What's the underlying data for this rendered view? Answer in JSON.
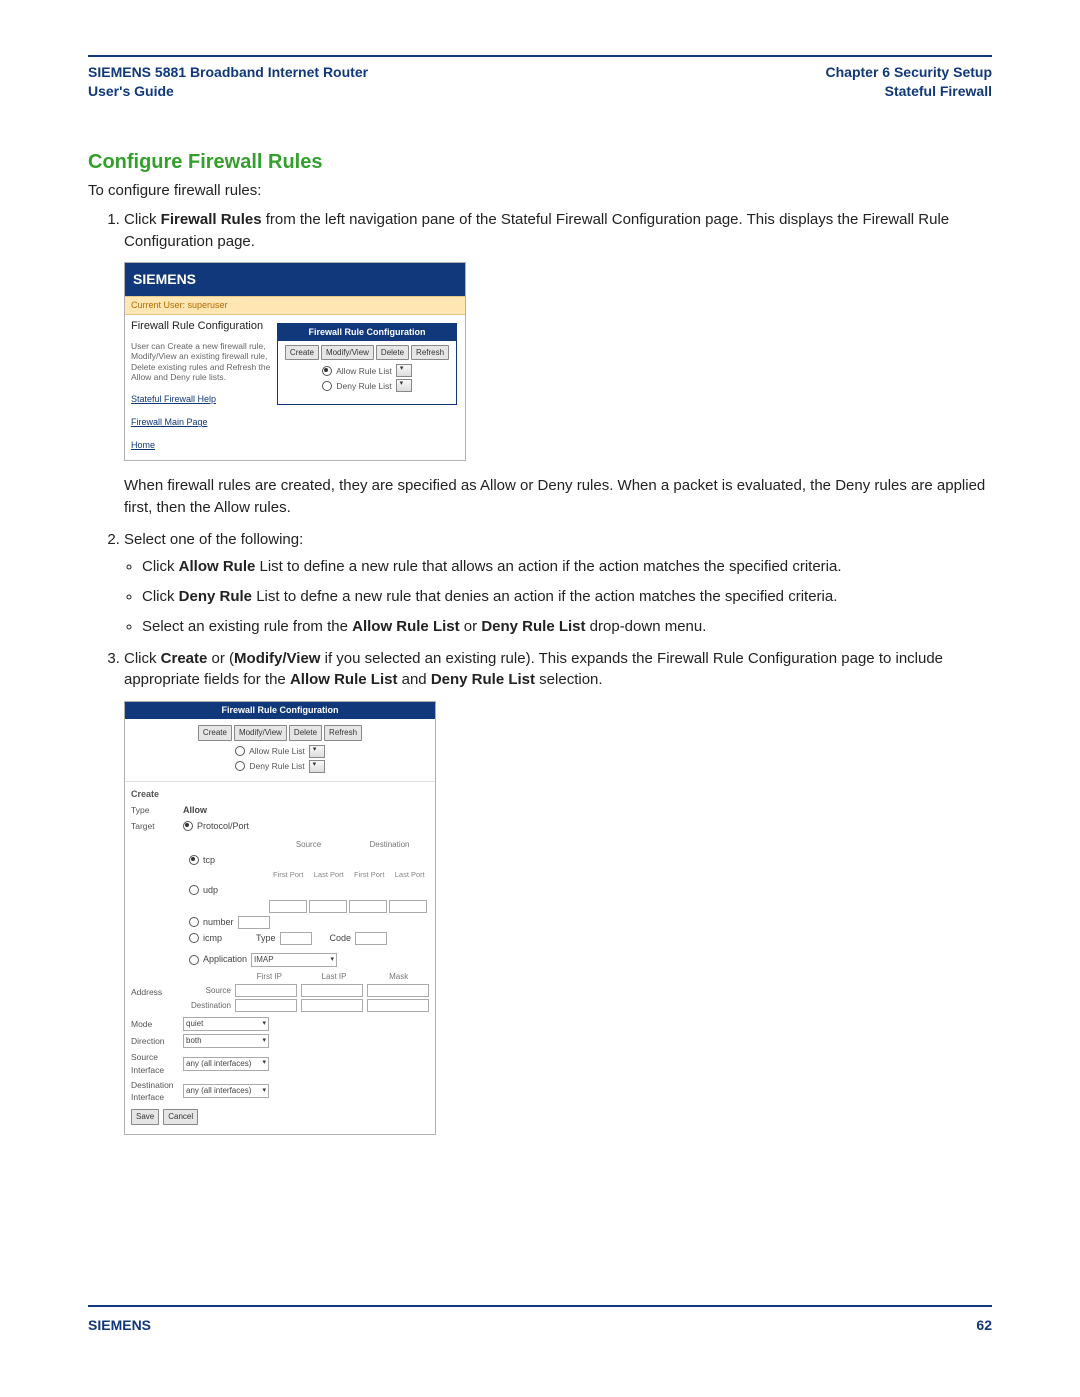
{
  "header": {
    "product": "SIEMENS 5881 Broadband Internet Router",
    "doc": "User's Guide",
    "chapter": "Chapter 6  Security Setup",
    "section": "Stateful Firewall"
  },
  "title": "Configure Firewall Rules",
  "intro": "To configure firewall rules:",
  "steps": {
    "s1a": "Click ",
    "s1b": "Firewall Rules",
    "s1c": " from the left navigation pane of the Stateful Firewall Configuration page. This displays the Firewall Rule Configuration page.",
    "s1_after": "When firewall rules are created, they are specified as Allow or Deny rules. When a packet is evaluated, the Deny rules are applied first, then the Allow rules.",
    "s2": "Select one of the following:",
    "s2_b1a": "Click ",
    "s2_b1b": "Allow Rule",
    "s2_b1c": " List to define a new rule that allows an action if the action matches the specified criteria.",
    "s2_b2a": "Click ",
    "s2_b2b": "Deny Rule",
    "s2_b2c": " List to defne a new rule that denies an action if the action matches the specified criteria.",
    "s2_b3a": "Select an existing rule from the ",
    "s2_b3b": "Allow Rule List",
    "s2_b3c": " or ",
    "s2_b3d": "Deny Rule List",
    "s2_b3e": " drop-down menu.",
    "s3a": "Click ",
    "s3b": "Create",
    "s3c": " or (",
    "s3d": "Modify/View",
    "s3e": " if you selected an existing rule). This expands the Firewall Rule Configuration page to include appropriate fields for the ",
    "s3f": "Allow Rule List",
    "s3g": " and ",
    "s3h": "Deny Rule List",
    "s3i": " selection."
  },
  "shot1": {
    "brand": "SIEMENS",
    "current_user": "Current User: superuser",
    "page_title": "Firewall Rule Configuration",
    "hint": "User can Create a new firewall rule, Modify/View an existing firewall rule, Delete existing rules and Refresh the Allow and Deny rule lists.",
    "help": "Stateful Firewall Help",
    "link_main": "Firewall Main Page",
    "link_home": "Home",
    "panel_title": "Firewall Rule Configuration",
    "btn_create": "Create",
    "btn_modify": "Modify/View",
    "btn_delete": "Delete",
    "btn_refresh": "Refresh",
    "allow_label": "Allow Rule List",
    "deny_label": "Deny Rule List"
  },
  "shot2": {
    "panel_title": "Firewall Rule Configuration",
    "btn_create": "Create",
    "btn_modify": "Modify/View",
    "btn_delete": "Delete",
    "btn_refresh": "Refresh",
    "allow_label": "Allow Rule List",
    "deny_label": "Deny Rule List",
    "create_section": "Create",
    "type_label": "Type",
    "type_value": "Allow",
    "target_label": "Target",
    "protocolport": "Protocol/Port",
    "tcp": "tcp",
    "udp": "udp",
    "number": "number",
    "icmp": "icmp",
    "source_hdr": "Source",
    "dest_hdr": "Destination",
    "first_port": "First Port",
    "last_port": "Last Port",
    "type_f": "Type",
    "code_f": "Code",
    "application": "Application",
    "app_value": "IMAP",
    "address": "Address",
    "first_ip": "First IP",
    "last_ip": "Last IP",
    "mask": "Mask",
    "src_sub": "Source",
    "dst_sub": "Destination",
    "mode": "Mode",
    "mode_val": "quiet",
    "direction": "Direction",
    "direction_val": "both",
    "src_if": "Source Interface",
    "dst_if": "Destination Interface",
    "if_val": "any (all interfaces)",
    "save": "Save",
    "cancel": "Cancel"
  },
  "footer": {
    "brand": "SIEMENS",
    "page": "62"
  }
}
